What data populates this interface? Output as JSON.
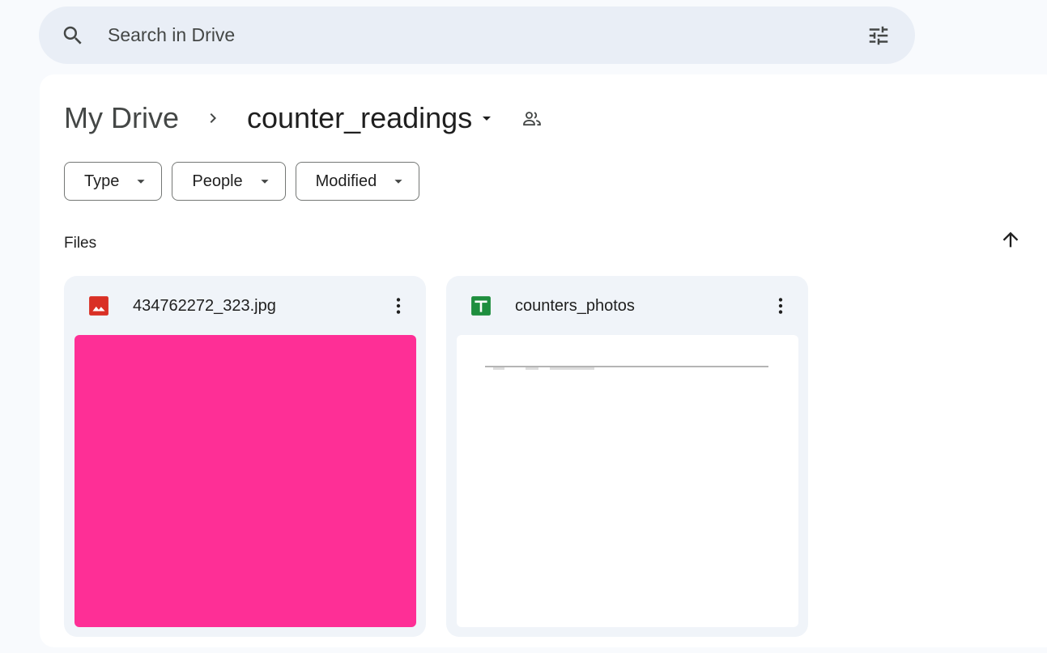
{
  "search": {
    "placeholder": "Search in Drive",
    "search_icon": "search-icon",
    "filter_icon": "tune-icon"
  },
  "breadcrumb": {
    "root": "My Drive",
    "separator_icon": "chevron-right-icon",
    "current": "counter_readings",
    "dropdown_icon": "arrow-drop-down-icon",
    "shared_icon": "people-icon"
  },
  "filters": [
    {
      "label": "Type"
    },
    {
      "label": "People"
    },
    {
      "label": "Modified"
    }
  ],
  "section": {
    "title": "Files",
    "sort_icon": "arrow-upward-icon"
  },
  "files": [
    {
      "name": "434762272_323.jpg",
      "icon": "image-file-icon",
      "icon_color": "#d93025",
      "thumbnail_color": "#fe2f96"
    },
    {
      "name": "counters_photos",
      "icon": "sheets-file-icon",
      "icon_color": "#1e8e3e",
      "thumbnail_color": "#ffffff"
    }
  ],
  "colors": {
    "page_background": "#f8fafd",
    "search_background": "#e9eef6",
    "card_background": "#f0f4f9"
  }
}
